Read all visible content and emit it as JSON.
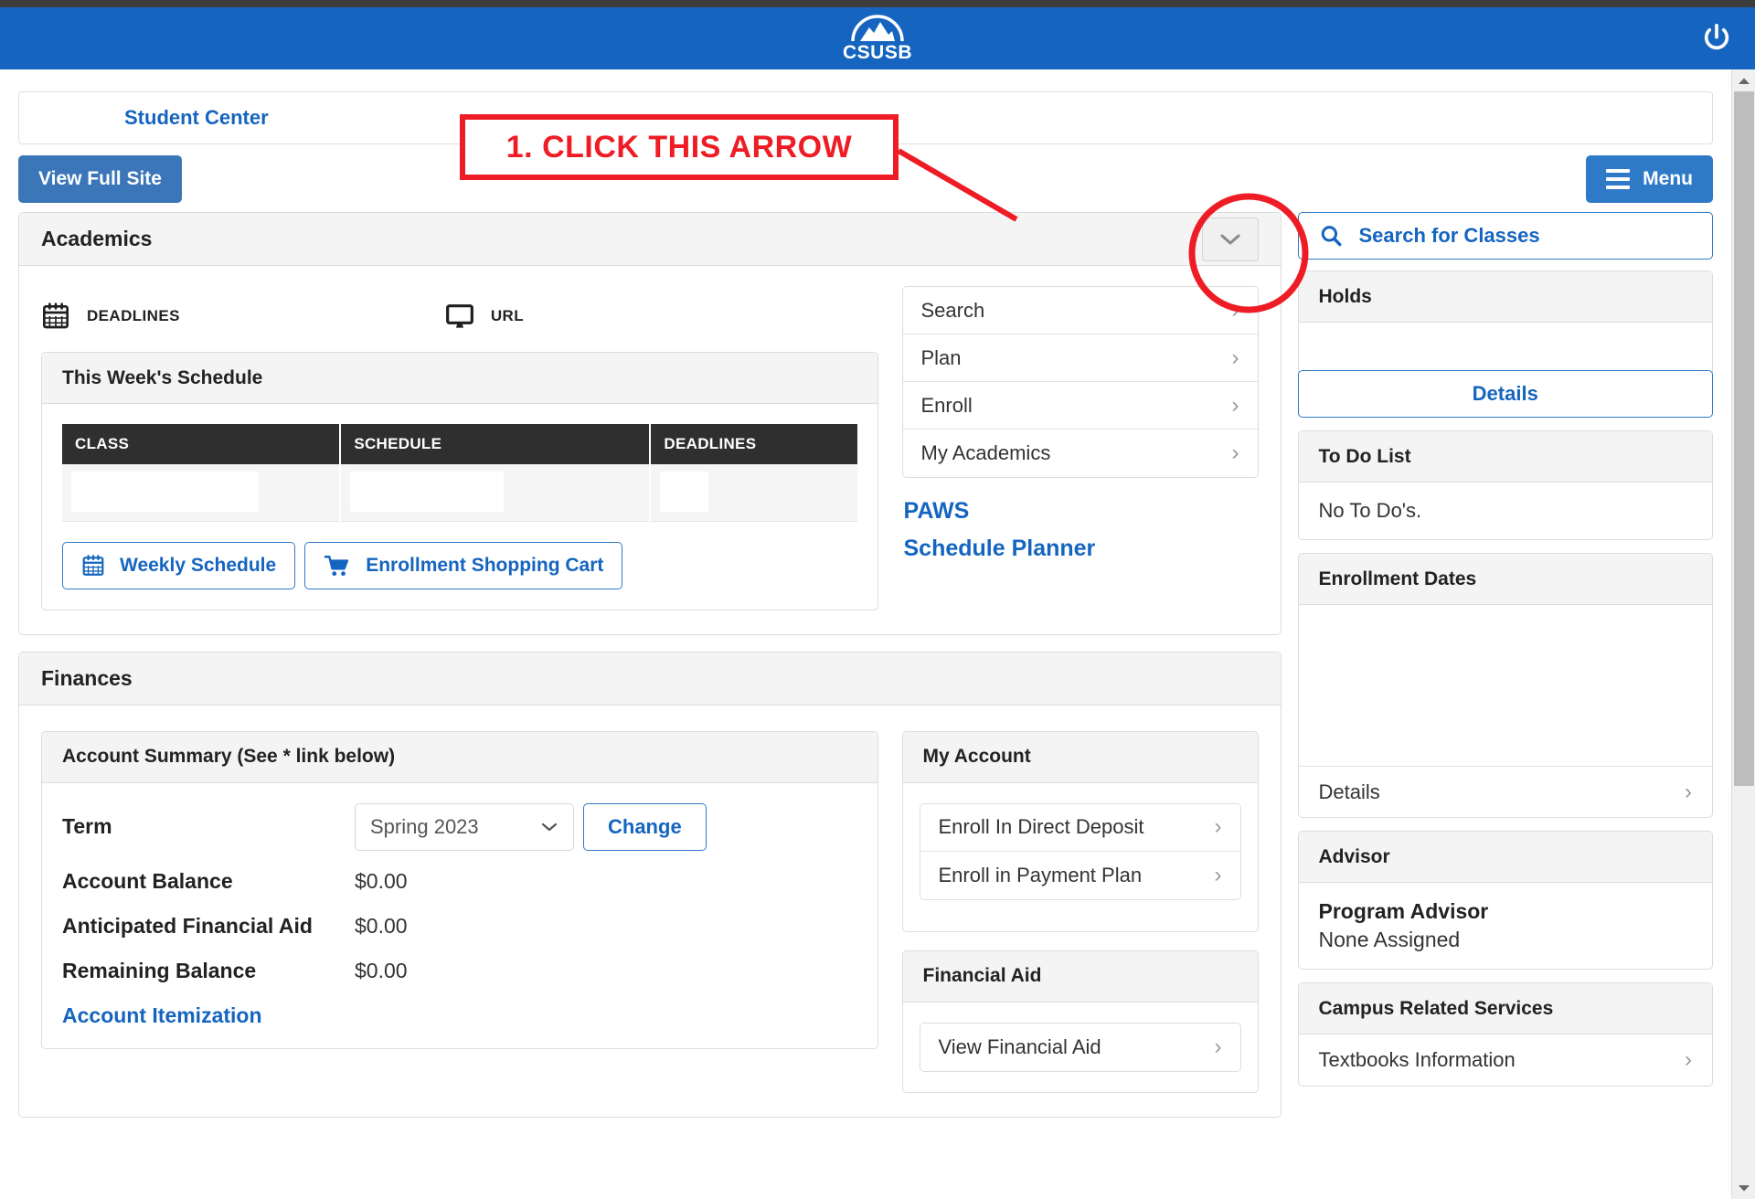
{
  "header": {
    "logo_word": "CSUSB",
    "logo_icon": "csusb-arch-mountain-logo",
    "power_icon": "power-icon"
  },
  "topbar": {
    "student_center_link": "Student Center",
    "view_full_site": "View Full Site",
    "menu_label": "Menu",
    "menu_icon": "hamburger-icon"
  },
  "annotation": {
    "text": "1. CLICK THIS ARROW",
    "color": "#ee1c24"
  },
  "academics": {
    "title": "Academics",
    "collapse_icon": "chevron-down-icon",
    "quick_icons": [
      {
        "label": "DEADLINES",
        "icon": "calendar-icon"
      },
      {
        "label": "URL",
        "icon": "monitor-icon"
      }
    ],
    "schedule": {
      "title": "This Week's Schedule",
      "columns": [
        "CLASS",
        "SCHEDULE",
        "DEADLINES"
      ],
      "rows": [
        [
          "",
          "",
          ""
        ]
      ],
      "buttons": [
        {
          "label": "Weekly Schedule",
          "icon": "calendar-icon"
        },
        {
          "label": "Enrollment Shopping Cart",
          "icon": "cart-icon"
        }
      ]
    },
    "links": [
      {
        "label": "Search"
      },
      {
        "label": "Plan"
      },
      {
        "label": "Enroll"
      },
      {
        "label": "My Academics"
      }
    ],
    "plain_links": [
      "PAWS",
      "Schedule Planner"
    ]
  },
  "finances": {
    "title": "Finances",
    "account_summary": {
      "title": "Account Summary (See * link below)",
      "term_label": "Term",
      "term_value": "Spring 2023",
      "change_label": "Change",
      "lines": [
        {
          "label": "Account Balance",
          "value": "$0.00"
        },
        {
          "label": "Anticipated Financial Aid",
          "value": "$0.00"
        },
        {
          "label": "Remaining Balance",
          "value": "$0.00"
        }
      ],
      "itemization_link": "Account Itemization"
    },
    "my_account": {
      "title": "My Account",
      "rows": [
        {
          "label": "Enroll In Direct Deposit"
        },
        {
          "label": "Enroll in Payment Plan"
        }
      ]
    },
    "financial_aid": {
      "title": "Financial Aid",
      "rows": [
        {
          "label": "View Financial Aid"
        }
      ]
    }
  },
  "sidebar": {
    "search_classes": {
      "label": "Search for Classes",
      "icon": "search-icon"
    },
    "holds": {
      "title": "Holds",
      "details_label": "Details"
    },
    "todo": {
      "title": "To Do List",
      "empty_text": "No To Do's."
    },
    "enrollment_dates": {
      "title": "Enrollment Dates",
      "details_label": "Details"
    },
    "advisor": {
      "title": "Advisor",
      "program_advisor_label": "Program Advisor",
      "program_advisor_value": "None Assigned"
    },
    "campus_services": {
      "title": "Campus Related Services",
      "rows": [
        {
          "label": "Textbooks Information"
        }
      ]
    }
  },
  "scrollbar": {
    "up_icon": "scroll-up-arrow",
    "down_icon": "scroll-down-arrow"
  }
}
